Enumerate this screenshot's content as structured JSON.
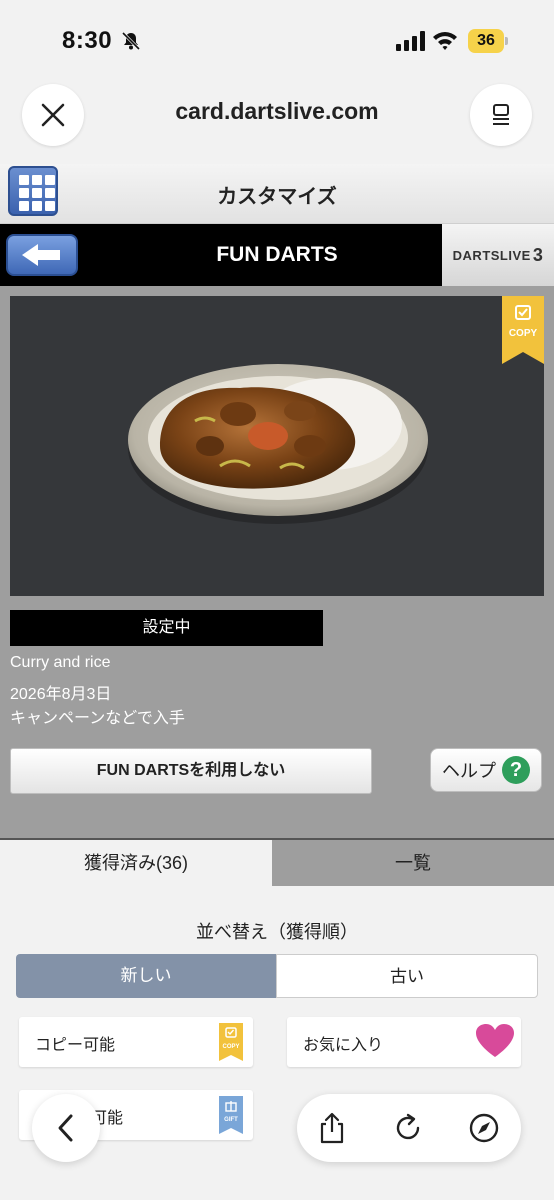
{
  "status_bar": {
    "time": "8:30",
    "battery": "36"
  },
  "browser": {
    "url": "card.dartslive.com"
  },
  "header": {
    "title": "カスタマイズ"
  },
  "section": {
    "title": "FUN DARTS",
    "brand": "DARTSLIVE",
    "brand_num": "3"
  },
  "item": {
    "ribbon_label": "COPY",
    "status": "設定中",
    "name": "Curry and rice",
    "date": "2026年8月3日",
    "source": "キャンペーンなどで入手"
  },
  "actions": {
    "disable_label": "FUN DARTSを利用しない",
    "help_label": "ヘルプ",
    "help_mark": "?"
  },
  "tabs": {
    "acquired": "獲得済み(36)",
    "list": "一覧"
  },
  "sort": {
    "label": "並べ替え（獲得順）",
    "newest": "新しい",
    "oldest": "古い"
  },
  "filters": {
    "copyable": "コピー可能",
    "copy_tag": "COPY",
    "favorite": "お気に入り",
    "giftable": "可能",
    "gift_tag": "GIFT"
  },
  "colors": {
    "accent": "#8392a8",
    "ribbon": "#f2c23c",
    "gift": "#7aa6d8",
    "heart": "#d84a9a"
  }
}
